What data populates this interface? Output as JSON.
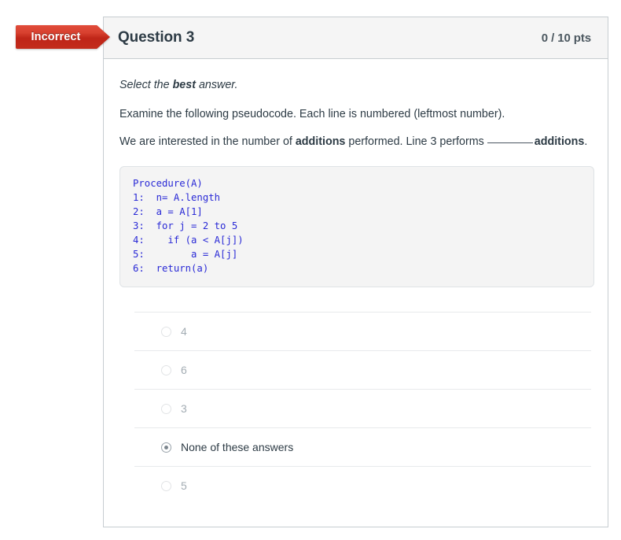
{
  "flag": {
    "label": "Incorrect",
    "color": "#c32c1c"
  },
  "header": {
    "title": "Question 3",
    "points": "0 / 10 pts"
  },
  "question": {
    "instruction_prefix": "Select the ",
    "instruction_bold": "best",
    "instruction_suffix": " answer.",
    "paragraph2": "Examine the following pseudocode. Each line is numbered (leftmost number).",
    "paragraph3_part1": "We are interested in the number of ",
    "paragraph3_bold1": "additions",
    "paragraph3_part2": " performed. Line 3 performs",
    "paragraph3_bold2": "additions",
    "paragraph3_part3": "."
  },
  "pseudocode": {
    "heading": "Procedure(A)",
    "lines": [
      "1:  n= A.length",
      "2:  a = A[1]",
      "3:  for j = 2 to 5",
      "4:    if (a < A[j])",
      "5:        a = A[j]",
      "6:  return(a)"
    ],
    "text": "1:  n= A.length\n2:  a = A[1]\n3:  for j = 2 to 5\n4:    if (a < A[j])\n5:        a = A[j]\n6:  return(a)",
    "color": "#2a2ad6"
  },
  "answers": [
    {
      "label": "4",
      "selected": false
    },
    {
      "label": "6",
      "selected": false
    },
    {
      "label": "3",
      "selected": false
    },
    {
      "label": "None of these answers",
      "selected": true
    },
    {
      "label": "5",
      "selected": false
    }
  ]
}
